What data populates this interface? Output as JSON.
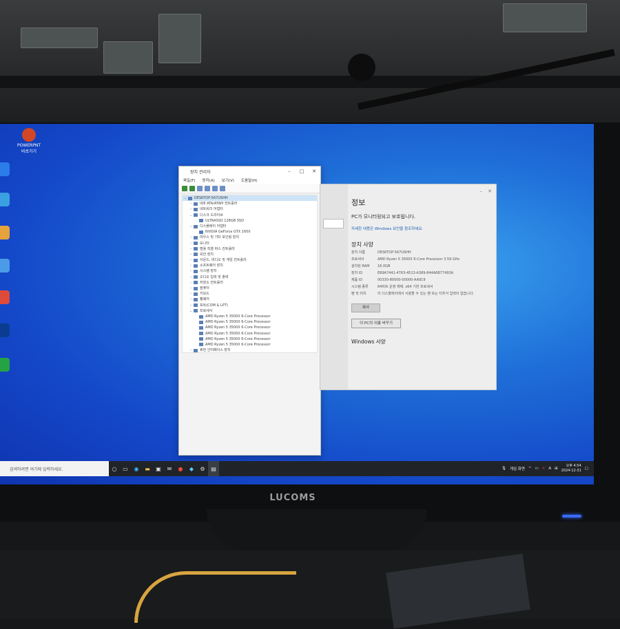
{
  "monitor_brand": "LUCOMS",
  "desktop": {
    "icons": [
      {
        "label": "POWERPNT\n바로가기",
        "color": "#d24726",
        "name": "powerpoint-icon"
      },
      {
        "label": "",
        "color": "#2b7de9",
        "name": "desktop-icon-2"
      },
      {
        "label": "",
        "color": "#3aa0e0",
        "name": "desktop-icon-3"
      },
      {
        "label": "",
        "color": "#e6a23c",
        "name": "desktop-icon-4"
      },
      {
        "label": "",
        "color": "#4b9be8",
        "name": "desktop-icon-5"
      },
      {
        "label": "",
        "color": "#de4a3a",
        "name": "chrome-icon"
      },
      {
        "label": "",
        "color": "#0a3d91",
        "name": "desktop-icon-7"
      },
      {
        "label": "",
        "color": "#25a244",
        "name": "desktop-icon-8"
      }
    ]
  },
  "device_manager": {
    "title": "장치 관리자",
    "menu": [
      "파일(F)",
      "동작(A)",
      "보기(V)",
      "도움말(H)"
    ],
    "tree": [
      {
        "label": "DESKTOP-567USHH",
        "exp": "⌄",
        "indent": 0,
        "selected": true
      },
      {
        "label": "IDE ATA/ATAPI 컨트롤러",
        "exp": "›",
        "indent": 1
      },
      {
        "label": "네트워크 어댑터",
        "exp": "›",
        "indent": 1
      },
      {
        "label": "디스크 드라이브",
        "exp": "⌄",
        "indent": 1
      },
      {
        "label": "ULTRASSD 128GB SSD",
        "exp": "",
        "indent": 2
      },
      {
        "label": "디스플레이 어댑터",
        "exp": "⌄",
        "indent": 1
      },
      {
        "label": "NVIDIA GeForce GTX 1650",
        "exp": "",
        "indent": 2
      },
      {
        "label": "마우스 및 기타 포인팅 장치",
        "exp": "›",
        "indent": 1
      },
      {
        "label": "모니터",
        "exp": "›",
        "indent": 1
      },
      {
        "label": "범용 직렬 버스 컨트롤러",
        "exp": "›",
        "indent": 1
      },
      {
        "label": "보안 장치",
        "exp": "›",
        "indent": 1
      },
      {
        "label": "사운드, 비디오 및 게임 컨트롤러",
        "exp": "›",
        "indent": 1
      },
      {
        "label": "소프트웨어 장치",
        "exp": "›",
        "indent": 1
      },
      {
        "label": "시스템 장치",
        "exp": "›",
        "indent": 1
      },
      {
        "label": "오디오 입력 및 출력",
        "exp": "›",
        "indent": 1
      },
      {
        "label": "저장소 컨트롤러",
        "exp": "›",
        "indent": 1
      },
      {
        "label": "컴퓨터",
        "exp": "›",
        "indent": 1
      },
      {
        "label": "키보드",
        "exp": "›",
        "indent": 1
      },
      {
        "label": "펌웨어",
        "exp": "›",
        "indent": 1
      },
      {
        "label": "포트(COM & LPT)",
        "exp": "›",
        "indent": 1
      },
      {
        "label": "프로세서",
        "exp": "⌄",
        "indent": 1
      },
      {
        "label": "AMD Ryzen 5 3500X 6-Core Processor",
        "exp": "",
        "indent": 2
      },
      {
        "label": "AMD Ryzen 5 3500X 6-Core Processor",
        "exp": "",
        "indent": 2
      },
      {
        "label": "AMD Ryzen 5 3500X 6-Core Processor",
        "exp": "",
        "indent": 2
      },
      {
        "label": "AMD Ryzen 5 3500X 6-Core Processor",
        "exp": "",
        "indent": 2
      },
      {
        "label": "AMD Ryzen 5 3500X 6-Core Processor",
        "exp": "",
        "indent": 2
      },
      {
        "label": "AMD Ryzen 5 3500X 6-Core Processor",
        "exp": "",
        "indent": 2
      },
      {
        "label": "휴먼 인터페이스 장치",
        "exp": "›",
        "indent": 1
      }
    ]
  },
  "system_info": {
    "title": "정보",
    "protect_text": "PC가 모니터링되고 보호됩니다.",
    "details_link": "자세한 내용은 Windows 보안을 참조하세요.",
    "device_spec_heading": "장치 사양",
    "specs": [
      {
        "key": "장치 이름",
        "value": "DESKTOP-567USHH"
      },
      {
        "key": "프로세서",
        "value": "AMD Ryzen 5 3500X 6-Core Processor 3.59 GHz"
      },
      {
        "key": "설치된 RAM",
        "value": "16.0GB"
      },
      {
        "key": "장치 ID",
        "value": "E89A7441-4763-4513-A389-844A6B77493A"
      },
      {
        "key": "제품 ID",
        "value": "00330-80000-00000-AA919"
      },
      {
        "key": "시스템 종류",
        "value": "64비트 운영 체제, x64 기반 프로세서"
      },
      {
        "key": "펜 및 터치",
        "value": "이 디스플레이에서 사용할 수 있는 펜 또는 터치식 입력이 없습니다."
      }
    ],
    "copy_button": "복사",
    "rename_button": "이 PC의 이름 바꾸기",
    "windows_spec_heading": "Windows 사양"
  },
  "taskbar": {
    "search_placeholder": "검색하려면 여기에 입력하세요.",
    "icons": [
      "cortana-icon",
      "edge-icon",
      "explorer-icon",
      "store-icon",
      "mail-icon",
      "chrome-icon",
      "vpn-icon",
      "settings-icon",
      "system-icon"
    ],
    "tray_text": "게임 화면",
    "lang": "A",
    "time": "오후 4:54",
    "date": "2024-12-31"
  }
}
